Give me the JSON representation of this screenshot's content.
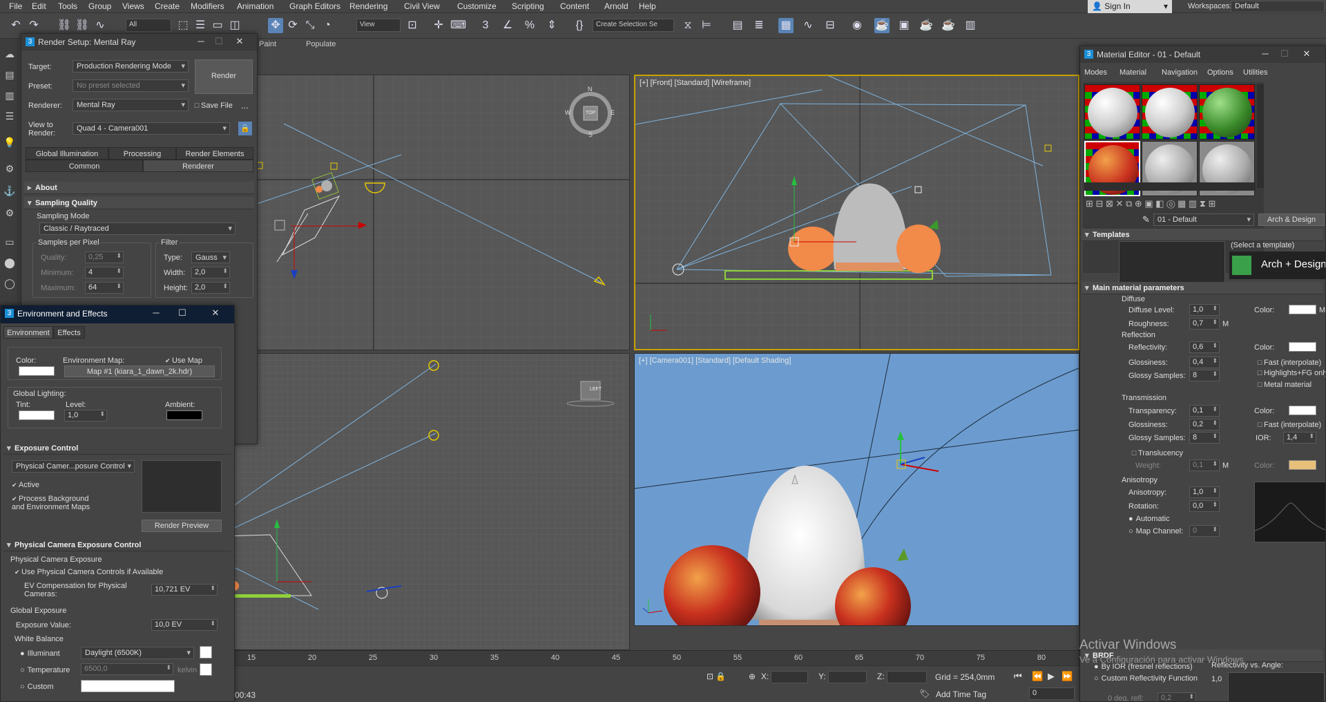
{
  "menu": [
    "File",
    "Edit",
    "Tools",
    "Group",
    "Views",
    "Create",
    "Modifiers",
    "Animation",
    "Graph Editors",
    "Rendering",
    "Civil View",
    "Customize",
    "Scripting",
    "Content",
    "Arnold",
    "Help"
  ],
  "signin": "Sign In",
  "workspaces": {
    "label": "Workspaces:",
    "value": "Default"
  },
  "toolbar": {
    "filter": "All",
    "ref_coord": "View",
    "selection_set": "Create Selection Se"
  },
  "ribbon": {
    "paint": "Paint",
    "populate": "Populate"
  },
  "viewports": {
    "front": "[+] [Front] [Standard] [Wireframe]",
    "camera": "[+] [Camera001] [Standard] [Default Shading]",
    "viewcube_top": "TOP",
    "viewcube_persp": "LEFT"
  },
  "compass": {
    "n": "N",
    "s": "S",
    "e": "E",
    "w": "W"
  },
  "axes": {
    "x": "x",
    "y": "y",
    "z": "z"
  },
  "render_setup": {
    "title": "Render Setup: Mental Ray",
    "target_label": "Target:",
    "target": "Production Rendering Mode",
    "preset_label": "Preset:",
    "preset": "No preset selected",
    "renderer_label": "Renderer:",
    "renderer": "Mental Ray",
    "save_file": "Save File",
    "more": "...",
    "view_label": "View to\nRender:",
    "view": "Quad 4 - Camera001",
    "render_button": "Render",
    "tabs": [
      "Global Illumination",
      "Processing",
      "Render Elements",
      "Common",
      "Renderer"
    ],
    "about": "About",
    "sampling_quality": "Sampling Quality",
    "sampling_mode_label": "Sampling Mode",
    "sampling_mode": "Classic / Raytraced",
    "samples_per_pixel": "Samples per Pixel",
    "filter": "Filter",
    "quality_label": "Quality:",
    "quality": "0,25",
    "minimum_label": "Minimum:",
    "minimum": "4",
    "maximum_label": "Maximum:",
    "maximum": "64",
    "type_label": "Type:",
    "type": "Gauss",
    "width_label": "Width:",
    "width": "2,0",
    "height_label": "Height:",
    "height": "2,0"
  },
  "env_effects": {
    "title": "Environment and Effects",
    "tabs": [
      "Environment",
      "Effects"
    ],
    "color_label": "Color:",
    "env_map_label": "Environment Map:",
    "use_map": "Use Map",
    "map_button": "Map #1 (kiara_1_dawn_2k.hdr)",
    "global_lighting": "Global Lighting:",
    "tint_label": "Tint:",
    "level_label": "Level:",
    "level": "1,0",
    "ambient_label": "Ambient:",
    "exposure_control": "Exposure Control",
    "exposure_type": "Physical Camer...posure Control",
    "active": "Active",
    "process_bg": "Process Background\nand Environment Maps",
    "render_preview": "Render Preview",
    "phys_cam_exposure_control": "Physical Camera Exposure Control",
    "phys_cam_exposure": "Physical Camera Exposure",
    "use_phys_controls": "Use Physical Camera Controls if Available",
    "ev_comp_label": "EV Compensation for Physical\nCameras:",
    "ev_comp": "10,721 EV",
    "global_exposure": "Global Exposure",
    "exposure_value_label": "Exposure Value:",
    "exposure_value": "10,0 EV",
    "white_balance": "White Balance",
    "illuminant": "Illuminant",
    "illuminant_value": "Daylight (6500K)",
    "temperature": "Temperature",
    "temperature_value": "6500,0",
    "kelvin": "kelvin",
    "custom": "Custom"
  },
  "material_editor": {
    "title": "Material Editor - 01 - Default",
    "menu": [
      "Modes",
      "Material",
      "Navigation",
      "Options",
      "Utilities"
    ],
    "material_name": "01 - Default",
    "type_button": "Arch & Design",
    "templates": "Templates",
    "select_template": "(Select a template)",
    "arch_design_logo": "Arch + Design",
    "main_params": "Main material parameters",
    "diffuse": "Diffuse",
    "diffuse_level_label": "Diffuse Level:",
    "diffuse_level": "1,0",
    "roughness_label": "Roughness:",
    "roughness": "0,7",
    "color_label": "Color:",
    "m": "M",
    "reflection": "Reflection",
    "reflectivity_label": "Reflectivity:",
    "reflectivity": "0,6",
    "glossiness_label": "Glossiness:",
    "glossiness": "0,4",
    "glossy_samples_label": "Glossy Samples:",
    "glossy_samples": "8",
    "fast_interpolate": "Fast (interpolate)",
    "highlights_fg": "Highlights+FG only",
    "metal_material": "Metal material",
    "transmission": "Transmission",
    "transparency_label": "Transparency:",
    "transparency": "0,1",
    "t_glossiness": "0,2",
    "t_glossy_samples": "8",
    "ior_label": "IOR:",
    "ior": "1,4",
    "translucency": "Translucency",
    "weight_label": "Weight:",
    "weight": "0,1",
    "anisotropy_section": "Anisotropy",
    "anisotropy_label": "Anisotropy:",
    "anisotropy": "1,0",
    "rotation_label": "Rotation:",
    "rotation": "0,0",
    "automatic": "Automatic",
    "map_channel_label": "Map Channel:",
    "map_channel": "0",
    "brdf": "BRDF",
    "by_ior": "By IOR (fresnel reflections)",
    "custom_refl": "Custom Reflectivity Function",
    "deg_refl": "0 deg. refl:",
    "deg_refl_value": "0,2",
    "refl_vs_angle": "Reflectivity vs. Angle:",
    "brdf_scale": "1,0"
  },
  "timeline": {
    "ticks": [
      "15",
      "20",
      "25",
      "30",
      "35",
      "40",
      "45",
      "50",
      "55",
      "60",
      "65",
      "70",
      "75",
      "80"
    ]
  },
  "status": {
    "time": "00:43",
    "x": "X:",
    "y": "Y:",
    "z": "Z:",
    "grid": "Grid = 254,0mm",
    "add_time_tag": "Add Time Tag",
    "frame": "0"
  },
  "watermark": {
    "line1": "Activar Windows",
    "line2": "Ve a Configuración para activar Windows."
  },
  "colors": {
    "accent": "#5a84b6",
    "viewport_bg": "#575757",
    "camera_bg": "#6c9ccf",
    "ui_bg": "#444444",
    "dialog_title_active": "#1f2a3a"
  }
}
